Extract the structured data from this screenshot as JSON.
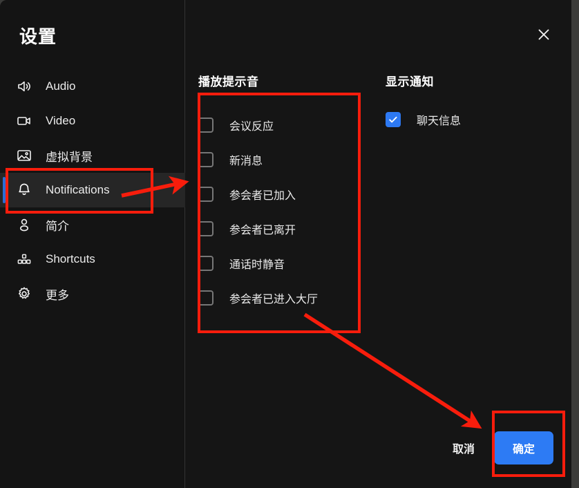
{
  "window": {
    "title": "设置",
    "close_label": "×"
  },
  "sidebar": {
    "items": [
      {
        "label": "Audio",
        "icon": "speaker-icon",
        "active": false
      },
      {
        "label": "Video",
        "icon": "video-camera-icon",
        "active": false
      },
      {
        "label": "虚拟背景",
        "icon": "image-icon",
        "active": false
      },
      {
        "label": "Notifications",
        "icon": "bell-icon",
        "active": true
      },
      {
        "label": "简介",
        "icon": "person-icon",
        "active": false
      },
      {
        "label": "Shortcuts",
        "icon": "keyboard-shortcut-icon",
        "active": false
      },
      {
        "label": "更多",
        "icon": "gear-icon",
        "active": false
      }
    ]
  },
  "main": {
    "sounds_section": {
      "title": "播放提示音",
      "items": [
        {
          "label": "会议反应",
          "checked": false
        },
        {
          "label": "新消息",
          "checked": false
        },
        {
          "label": "参会者已加入",
          "checked": false
        },
        {
          "label": "参会者已离开",
          "checked": false
        },
        {
          "label": "通话时静音",
          "checked": false
        },
        {
          "label": "参会者已进入大厅",
          "checked": false
        }
      ]
    },
    "notify_section": {
      "title": "显示通知",
      "items": [
        {
          "label": "聊天信息",
          "checked": true
        }
      ]
    },
    "footer": {
      "cancel_label": "取消",
      "ok_label": "确定"
    }
  },
  "annotations": {
    "highlight_color": "#f81d0c",
    "boxes": [
      {
        "name": "notifications-nav-highlight"
      },
      {
        "name": "play-sounds-highlight"
      },
      {
        "name": "confirm-button-highlight"
      }
    ],
    "arrows": [
      {
        "name": "arrow-to-notifications-panel"
      },
      {
        "name": "arrow-to-confirm-button"
      }
    ]
  },
  "colors": {
    "accent_blue": "#2d7bf4",
    "window_bg": "#151515",
    "sidebar_bg": "#141414",
    "active_item_bg": "#262626"
  }
}
